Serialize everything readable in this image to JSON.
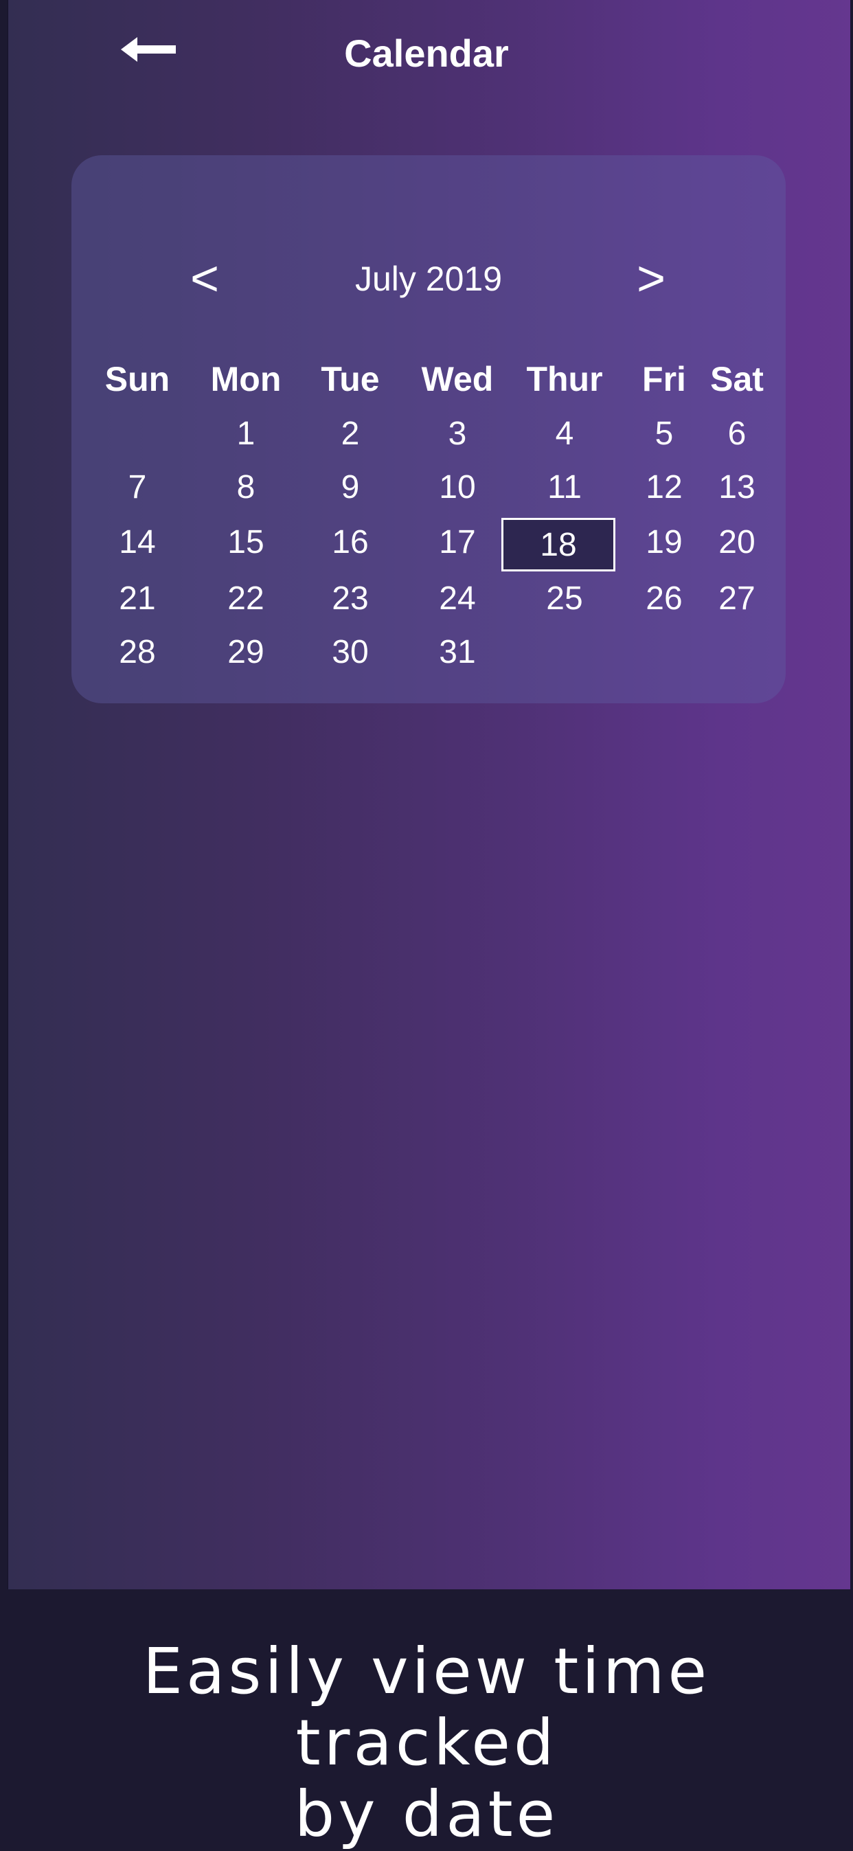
{
  "header": {
    "title": "Calendar",
    "back_icon": "arrow-left-icon"
  },
  "calendar": {
    "month_label": "July 2019",
    "prev_label": "<",
    "next_label": ">",
    "weekdays": [
      "Sun",
      "Mon",
      "Tue",
      "Wed",
      "Thur",
      "Fri",
      "Sat"
    ],
    "weeks": [
      [
        "",
        "1",
        "2",
        "3",
        "4",
        "5",
        "6"
      ],
      [
        "7",
        "8",
        "9",
        "10",
        "11",
        "12",
        "13"
      ],
      [
        "14",
        "15",
        "16",
        "17",
        "18",
        "19",
        "20"
      ],
      [
        "21",
        "22",
        "23",
        "24",
        "25",
        "26",
        "27"
      ],
      [
        "28",
        "29",
        "30",
        "31",
        "",
        "",
        ""
      ]
    ],
    "selected_day": "18"
  },
  "caption": {
    "line1": "Easily view time tracked",
    "line2": "by date"
  },
  "colors": {
    "background_start": "#332e52",
    "background_end": "#65378f",
    "card": "#4d4380",
    "selected_fill": "#2d2650",
    "caption_bar": "#1c1930",
    "text": "#ffffff"
  }
}
